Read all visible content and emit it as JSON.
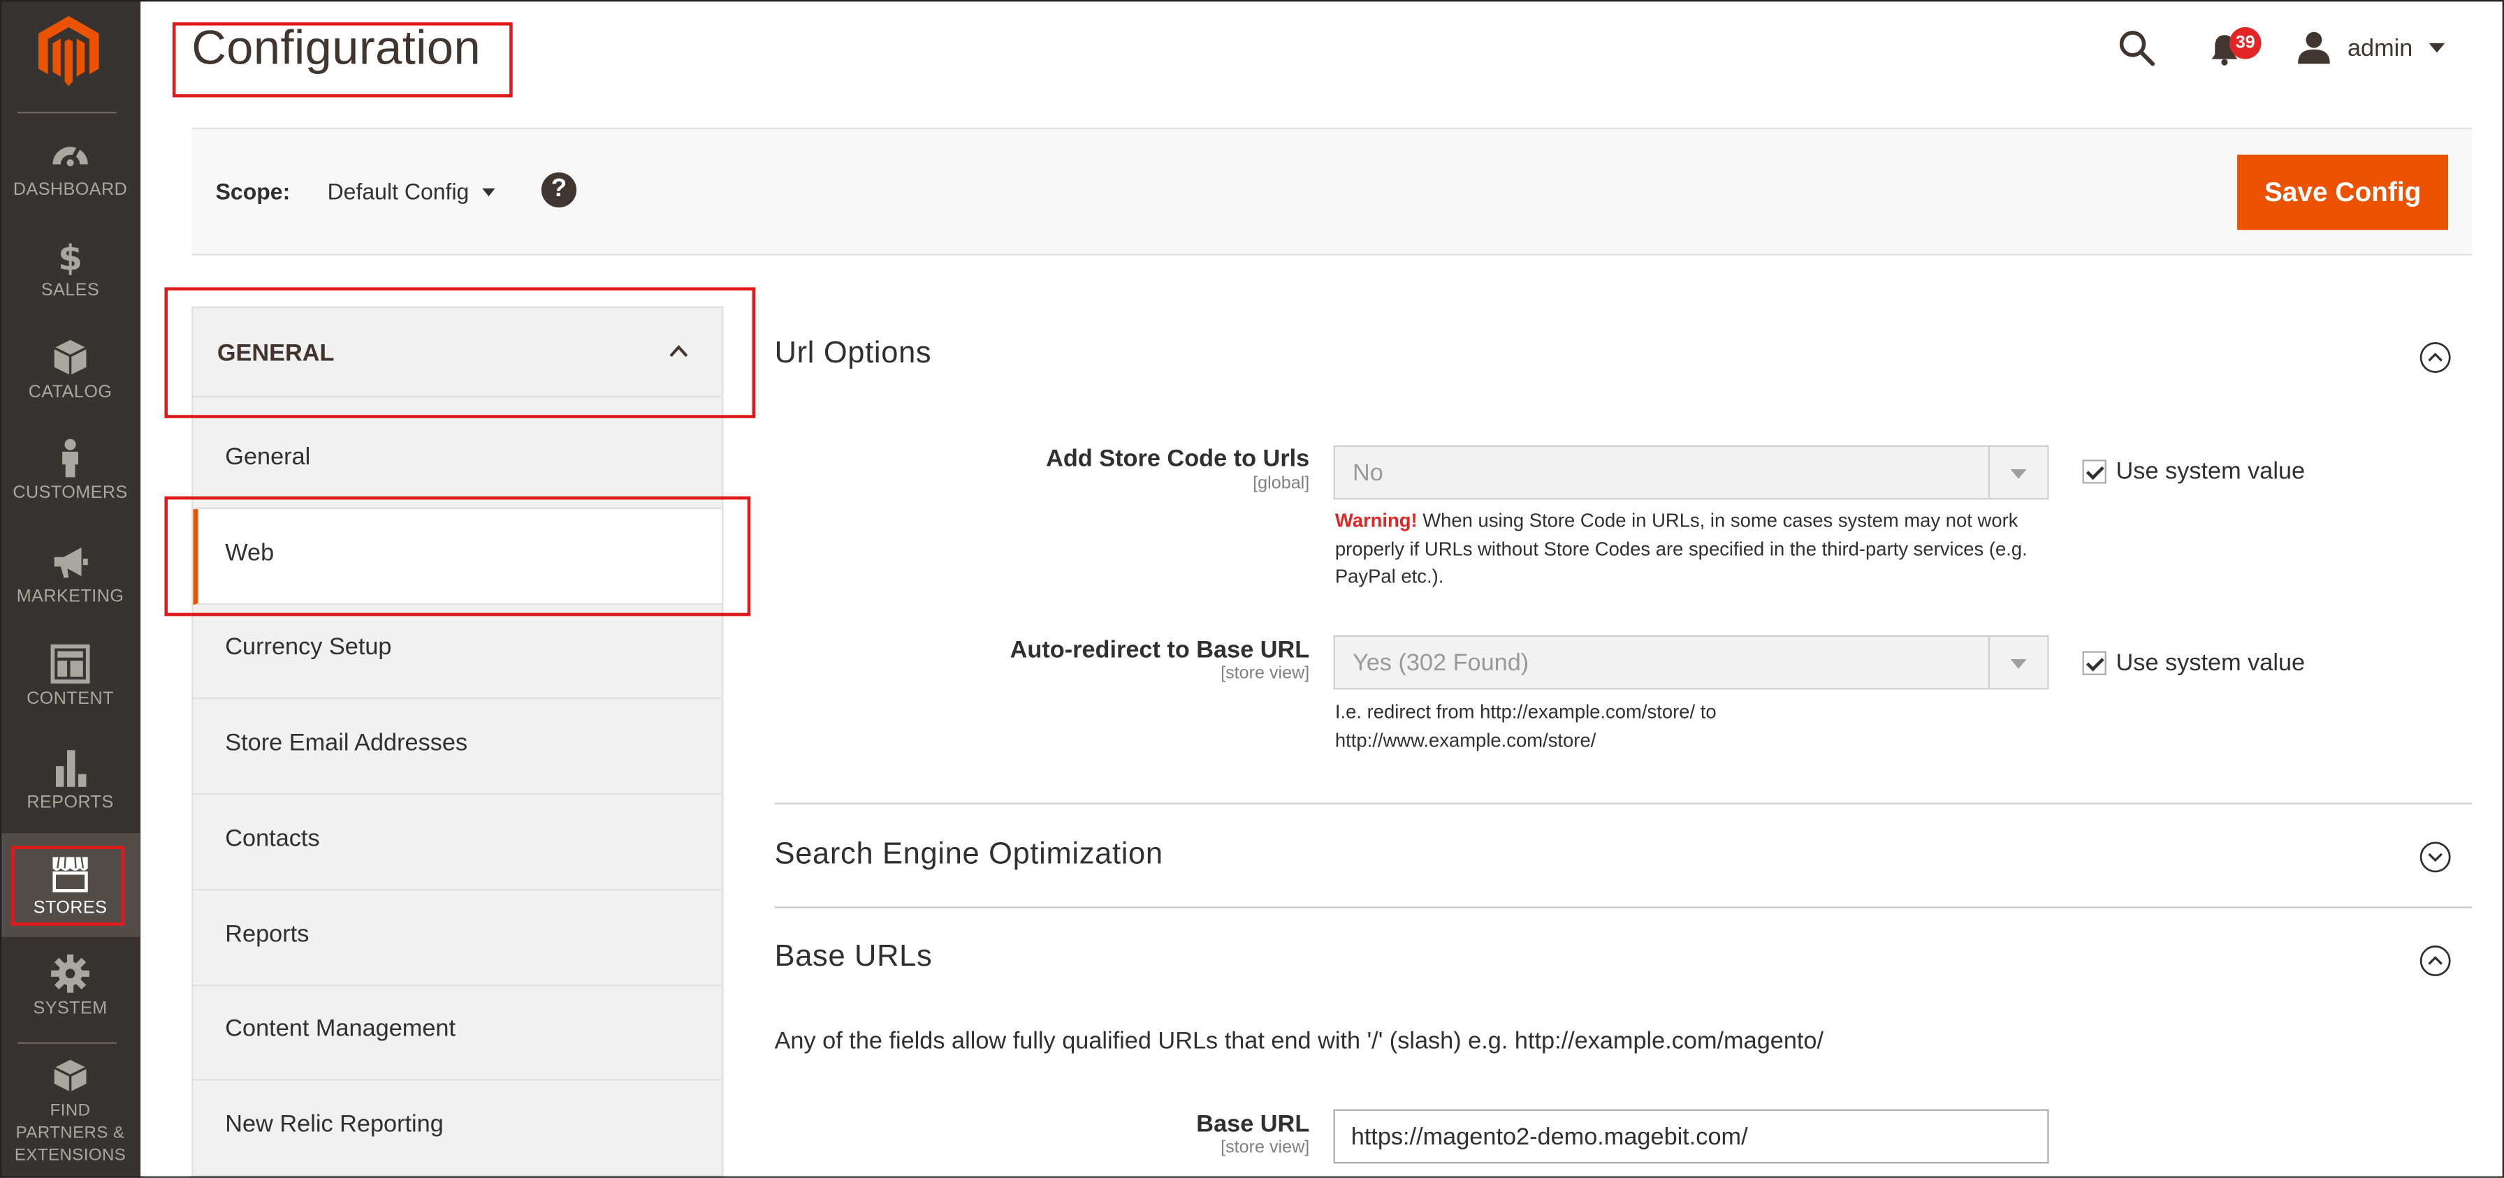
{
  "nav": {
    "items": [
      {
        "label": "DASHBOARD",
        "icon": "dashboard-icon"
      },
      {
        "label": "SALES",
        "icon": "dollar-icon"
      },
      {
        "label": "CATALOG",
        "icon": "box-icon"
      },
      {
        "label": "CUSTOMERS",
        "icon": "person-icon"
      },
      {
        "label": "MARKETING",
        "icon": "megaphone-icon"
      },
      {
        "label": "CONTENT",
        "icon": "layout-icon"
      },
      {
        "label": "REPORTS",
        "icon": "bar-chart-icon"
      },
      {
        "label": "STORES",
        "icon": "storefront-icon",
        "active": true
      },
      {
        "label": "SYSTEM",
        "icon": "gear-icon"
      },
      {
        "label": "FIND PARTNERS & EXTENSIONS",
        "icon": "extensions-icon"
      }
    ]
  },
  "header": {
    "title": "Configuration",
    "notifications_count": "39",
    "user_name": "admin"
  },
  "scope": {
    "label": "Scope:",
    "value": "Default Config",
    "help": "?"
  },
  "toolbar": {
    "save_label": "Save Config"
  },
  "tabs": {
    "group_title": "GENERAL",
    "items": [
      {
        "label": "General"
      },
      {
        "label": "Web",
        "active": true
      },
      {
        "label": "Currency Setup"
      },
      {
        "label": "Store Email Addresses"
      },
      {
        "label": "Contacts"
      },
      {
        "label": "Reports"
      },
      {
        "label": "Content Management"
      },
      {
        "label": "New Relic Reporting"
      }
    ]
  },
  "sections": {
    "url_options": {
      "title": "Url Options",
      "expanded": true,
      "add_store_code": {
        "label": "Add Store Code to Urls",
        "scope": "[global]",
        "value": "No",
        "use_system": "Use system value",
        "warning_strong": "Warning!",
        "warning_text": " When using Store Code in URLs, in some cases system may not work properly if URLs without Store Codes are specified in the third-party services (e.g. PayPal etc.)."
      },
      "auto_redirect": {
        "label": "Auto-redirect to Base URL",
        "scope": "[store view]",
        "value": "Yes (302 Found)",
        "use_system": "Use system value",
        "note": "I.e. redirect from http://example.com/store/ to http://www.example.com/store/"
      }
    },
    "seo": {
      "title": "Search Engine Optimization",
      "expanded": false
    },
    "base_urls": {
      "title": "Base URLs",
      "expanded": true,
      "description": "Any of the fields allow fully qualified URLs that end with '/' (slash) e.g. http://example.com/magento/",
      "base_url": {
        "label": "Base URL",
        "scope": "[store view]",
        "value": "https://magento2-demo.magebit.com/"
      }
    }
  },
  "colors": {
    "accent": "#eb5202",
    "nav_bg": "#373330",
    "highlight_red": "#e01a1a"
  }
}
